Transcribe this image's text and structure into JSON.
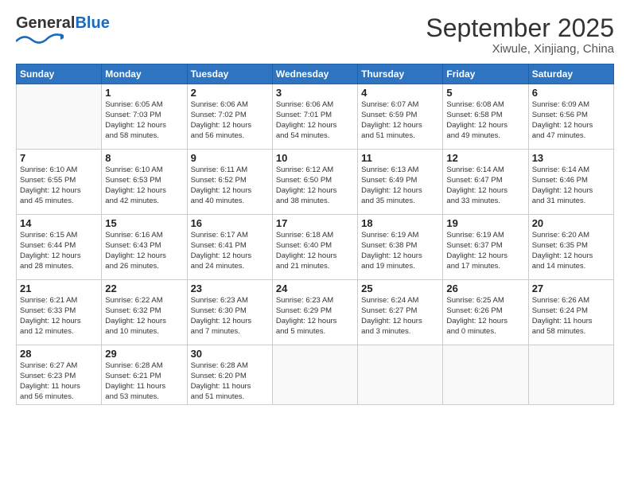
{
  "header": {
    "logo_general": "General",
    "logo_blue": "Blue",
    "title": "September 2025",
    "subtitle": "Xiwule, Xinjiang, China"
  },
  "calendar": {
    "headers": [
      "Sunday",
      "Monday",
      "Tuesday",
      "Wednesday",
      "Thursday",
      "Friday",
      "Saturday"
    ],
    "weeks": [
      [
        {
          "day": "",
          "info": ""
        },
        {
          "day": "1",
          "info": "Sunrise: 6:05 AM\nSunset: 7:03 PM\nDaylight: 12 hours\nand 58 minutes."
        },
        {
          "day": "2",
          "info": "Sunrise: 6:06 AM\nSunset: 7:02 PM\nDaylight: 12 hours\nand 56 minutes."
        },
        {
          "day": "3",
          "info": "Sunrise: 6:06 AM\nSunset: 7:01 PM\nDaylight: 12 hours\nand 54 minutes."
        },
        {
          "day": "4",
          "info": "Sunrise: 6:07 AM\nSunset: 6:59 PM\nDaylight: 12 hours\nand 51 minutes."
        },
        {
          "day": "5",
          "info": "Sunrise: 6:08 AM\nSunset: 6:58 PM\nDaylight: 12 hours\nand 49 minutes."
        },
        {
          "day": "6",
          "info": "Sunrise: 6:09 AM\nSunset: 6:56 PM\nDaylight: 12 hours\nand 47 minutes."
        }
      ],
      [
        {
          "day": "7",
          "info": "Sunrise: 6:10 AM\nSunset: 6:55 PM\nDaylight: 12 hours\nand 45 minutes."
        },
        {
          "day": "8",
          "info": "Sunrise: 6:10 AM\nSunset: 6:53 PM\nDaylight: 12 hours\nand 42 minutes."
        },
        {
          "day": "9",
          "info": "Sunrise: 6:11 AM\nSunset: 6:52 PM\nDaylight: 12 hours\nand 40 minutes."
        },
        {
          "day": "10",
          "info": "Sunrise: 6:12 AM\nSunset: 6:50 PM\nDaylight: 12 hours\nand 38 minutes."
        },
        {
          "day": "11",
          "info": "Sunrise: 6:13 AM\nSunset: 6:49 PM\nDaylight: 12 hours\nand 35 minutes."
        },
        {
          "day": "12",
          "info": "Sunrise: 6:14 AM\nSunset: 6:47 PM\nDaylight: 12 hours\nand 33 minutes."
        },
        {
          "day": "13",
          "info": "Sunrise: 6:14 AM\nSunset: 6:46 PM\nDaylight: 12 hours\nand 31 minutes."
        }
      ],
      [
        {
          "day": "14",
          "info": "Sunrise: 6:15 AM\nSunset: 6:44 PM\nDaylight: 12 hours\nand 28 minutes."
        },
        {
          "day": "15",
          "info": "Sunrise: 6:16 AM\nSunset: 6:43 PM\nDaylight: 12 hours\nand 26 minutes."
        },
        {
          "day": "16",
          "info": "Sunrise: 6:17 AM\nSunset: 6:41 PM\nDaylight: 12 hours\nand 24 minutes."
        },
        {
          "day": "17",
          "info": "Sunrise: 6:18 AM\nSunset: 6:40 PM\nDaylight: 12 hours\nand 21 minutes."
        },
        {
          "day": "18",
          "info": "Sunrise: 6:19 AM\nSunset: 6:38 PM\nDaylight: 12 hours\nand 19 minutes."
        },
        {
          "day": "19",
          "info": "Sunrise: 6:19 AM\nSunset: 6:37 PM\nDaylight: 12 hours\nand 17 minutes."
        },
        {
          "day": "20",
          "info": "Sunrise: 6:20 AM\nSunset: 6:35 PM\nDaylight: 12 hours\nand 14 minutes."
        }
      ],
      [
        {
          "day": "21",
          "info": "Sunrise: 6:21 AM\nSunset: 6:33 PM\nDaylight: 12 hours\nand 12 minutes."
        },
        {
          "day": "22",
          "info": "Sunrise: 6:22 AM\nSunset: 6:32 PM\nDaylight: 12 hours\nand 10 minutes."
        },
        {
          "day": "23",
          "info": "Sunrise: 6:23 AM\nSunset: 6:30 PM\nDaylight: 12 hours\nand 7 minutes."
        },
        {
          "day": "24",
          "info": "Sunrise: 6:23 AM\nSunset: 6:29 PM\nDaylight: 12 hours\nand 5 minutes."
        },
        {
          "day": "25",
          "info": "Sunrise: 6:24 AM\nSunset: 6:27 PM\nDaylight: 12 hours\nand 3 minutes."
        },
        {
          "day": "26",
          "info": "Sunrise: 6:25 AM\nSunset: 6:26 PM\nDaylight: 12 hours\nand 0 minutes."
        },
        {
          "day": "27",
          "info": "Sunrise: 6:26 AM\nSunset: 6:24 PM\nDaylight: 11 hours\nand 58 minutes."
        }
      ],
      [
        {
          "day": "28",
          "info": "Sunrise: 6:27 AM\nSunset: 6:23 PM\nDaylight: 11 hours\nand 56 minutes."
        },
        {
          "day": "29",
          "info": "Sunrise: 6:28 AM\nSunset: 6:21 PM\nDaylight: 11 hours\nand 53 minutes."
        },
        {
          "day": "30",
          "info": "Sunrise: 6:28 AM\nSunset: 6:20 PM\nDaylight: 11 hours\nand 51 minutes."
        },
        {
          "day": "",
          "info": ""
        },
        {
          "day": "",
          "info": ""
        },
        {
          "day": "",
          "info": ""
        },
        {
          "day": "",
          "info": ""
        }
      ]
    ]
  }
}
